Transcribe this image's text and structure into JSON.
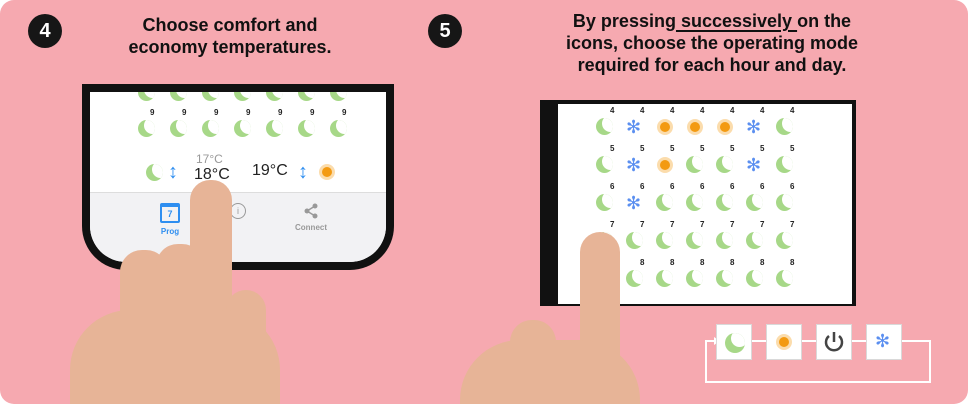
{
  "step4": {
    "badge": "4",
    "line1": "Choose comfort and",
    "line2": "economy temperatures."
  },
  "step5": {
    "badge": "5",
    "line1_pre": "By pressing",
    "line1_u": " successively ",
    "line1_post": "on the",
    "line2": "icons, choose the operating mode",
    "line3": "required for each hour and day."
  },
  "phone_left": {
    "hour_label": "9",
    "temp_comfort": "19°C",
    "temp_economy_prev": "17°C",
    "temp_economy": "18°C",
    "tabs": [
      {
        "label": "Prog",
        "icon": "calendar-icon",
        "date": "7"
      },
      {
        "label": "",
        "icon": "info-icon"
      },
      {
        "label": "Connect",
        "icon": "share-icon"
      }
    ]
  },
  "phone_right": {
    "rows": [
      {
        "hour": "4",
        "modes": [
          "moon",
          "snow",
          "sun",
          "sun",
          "sun",
          "snow",
          "moon"
        ]
      },
      {
        "hour": "5",
        "modes": [
          "moon",
          "snow",
          "sun",
          "moon",
          "moon",
          "snow",
          "moon"
        ]
      },
      {
        "hour": "6",
        "modes": [
          "moon",
          "snow",
          "moon",
          "moon",
          "moon",
          "moon",
          "moon"
        ]
      },
      {
        "hour": "7",
        "modes": [
          "moon",
          "moon",
          "moon",
          "moon",
          "moon",
          "moon",
          "moon"
        ]
      },
      {
        "hour": "8",
        "modes": [
          "moon",
          "moon",
          "moon",
          "moon",
          "moon",
          "moon",
          "moon"
        ]
      }
    ]
  },
  "mode_cycle": [
    "moon-icon",
    "sun-icon",
    "power-icon",
    "snowflake-icon"
  ],
  "colors": {
    "background": "#f6a9b0",
    "comfort_green": "#a7d888",
    "sun_orange": "#f39a12",
    "snow_blue": "#5b8ff0",
    "accent_blue": "#2e8ef0"
  }
}
